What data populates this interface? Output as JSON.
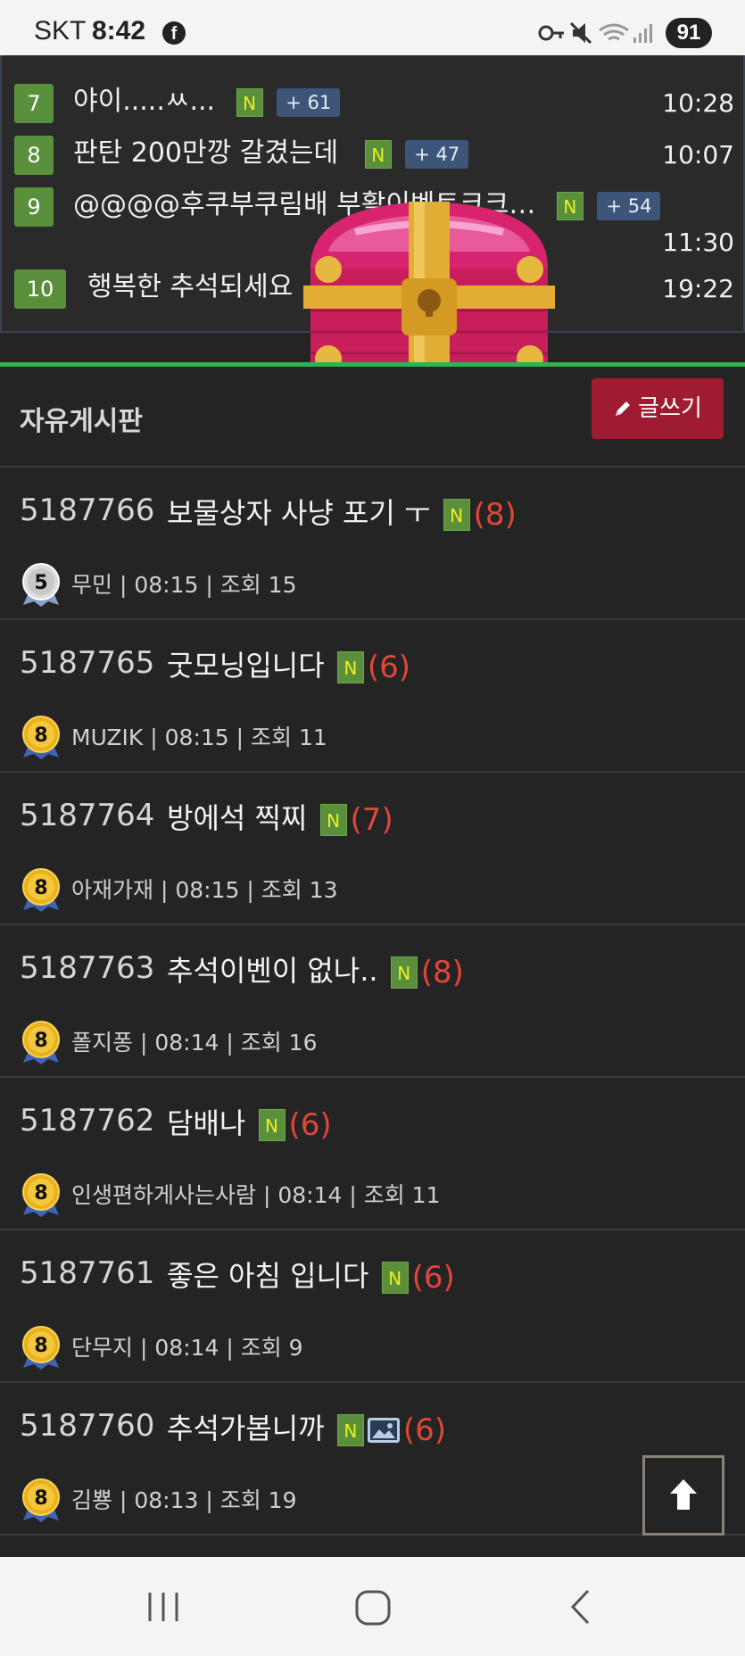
{
  "status_bar": {
    "carrier": "SKT",
    "time": "8:42",
    "battery": "91"
  },
  "best_list": {
    "items": [
      {
        "rank": "7",
        "title": "야이.....ㅆ...",
        "new": "N",
        "plus": "+ 61",
        "time": "10:28"
      },
      {
        "rank": "8",
        "title": "판탄 200만깡 갈겼는데",
        "new": "N",
        "plus": "+ 47",
        "time": "10:07"
      },
      {
        "rank": "9",
        "title": "@@@@후쿠부쿠림배 부활이벤트크크…",
        "new": "N",
        "plus": "+ 54",
        "time": "11:30"
      },
      {
        "rank": "10",
        "title": "행복한 추석되세요 ",
        "time": "19:22"
      }
    ]
  },
  "board": {
    "title": "자유게시판",
    "write_label": "글쓰기"
  },
  "posts": [
    {
      "id": "5187766",
      "title": "보물상자 사냥 포기 ㅜ",
      "new": "N",
      "comments": "(8)",
      "level": "5",
      "author": "무민",
      "time": "08:15",
      "views": "조회 15"
    },
    {
      "id": "5187765",
      "title": "굿모닝입니다",
      "new": "N",
      "comments": "(6)",
      "level": "8",
      "author": "MUZIK",
      "time": "08:15",
      "views": "조회 11"
    },
    {
      "id": "5187764",
      "title": "방에석 찍찌",
      "new": "N",
      "comments": "(7)",
      "level": "8",
      "author": "아재가재",
      "time": "08:15",
      "views": "조회 13"
    },
    {
      "id": "5187763",
      "title": "추석이벤이 없나..",
      "new": "N",
      "comments": "(8)",
      "level": "8",
      "author": "폴지퐁",
      "time": "08:14",
      "views": "조회 16"
    },
    {
      "id": "5187762",
      "title": "담배나",
      "new": "N",
      "comments": "(6)",
      "level": "8",
      "author": "인생편하게사는사람",
      "time": "08:14",
      "views": "조회 11"
    },
    {
      "id": "5187761",
      "title": "좋은 아침 입니다",
      "new": "N",
      "comments": "(6)",
      "level": "8",
      "author": "단무지",
      "time": "08:14",
      "views": "조회 9"
    },
    {
      "id": "5187760",
      "title": "추석가봅니까",
      "new": "N",
      "comments": "(6)",
      "level": "8",
      "author": "김뿅",
      "time": "08:13",
      "views": "조회 19",
      "has_image": true
    }
  ],
  "colors": {
    "accent_green": "#2fb352",
    "write_button": "#9e1b32",
    "comment_count": "#e0463a",
    "new_badge": "#5a8f3c"
  }
}
